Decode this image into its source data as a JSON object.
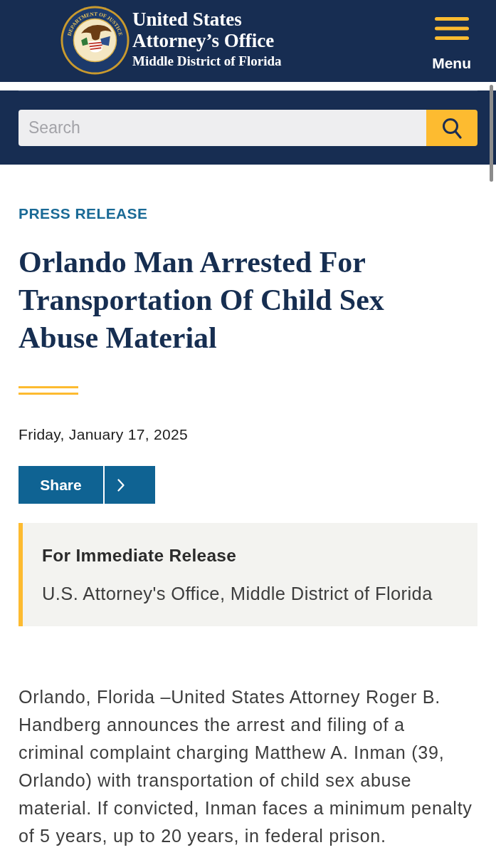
{
  "header": {
    "seal": {
      "ring_text": "DEPARTMENT OF JUSTICE"
    },
    "title": "United States Attorney’s Office",
    "subtitle": "Middle District of Florida",
    "menu": {
      "label": "Menu"
    }
  },
  "search": {
    "placeholder": "Search"
  },
  "article": {
    "category": "PRESS RELEASE",
    "title": "Orlando Man Arrested For Transportation Of Child Sex Abuse Material",
    "date": "Friday, January 17, 2025",
    "share": {
      "label": "Share"
    },
    "release_box": {
      "heading": "For Immediate Release",
      "source": "U.S. Attorney's Office, Middle District of Florida"
    },
    "paragraphs": [
      "Orlando, Florida –United States Attorney Roger B. Handberg announces the arrest and filing of a criminal complaint charging Matthew A. Inman (39, Orlando) with transportation of child sex abuse material. If convicted, Inman faces a minimum penalty of 5 years, up to 20 years, in federal prison."
    ]
  }
}
